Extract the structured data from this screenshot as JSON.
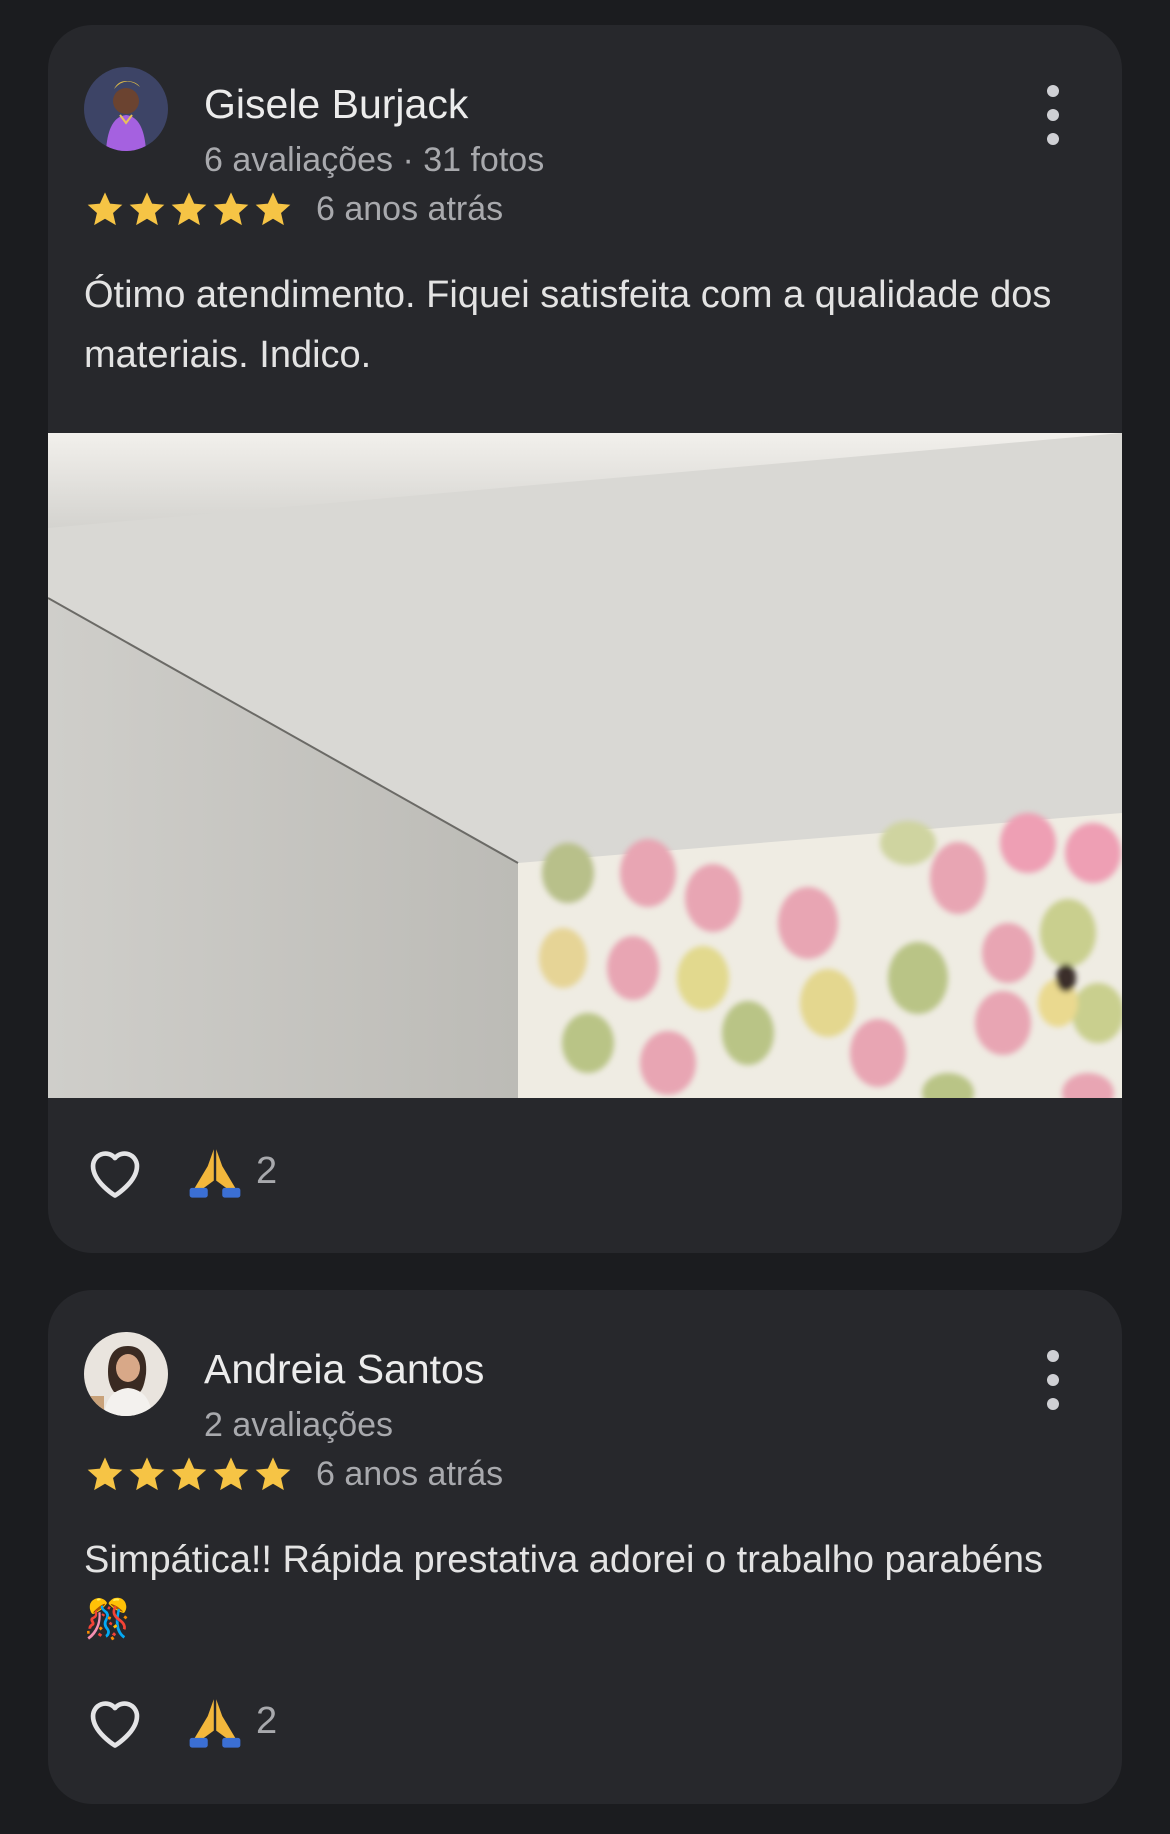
{
  "reviews": [
    {
      "author": "Gisele Burjack",
      "meta": "6 avaliações · 31 fotos",
      "rating": 5,
      "time": "6 anos atrás",
      "text": "Ótimo atendimento. Fiquei satisfeita com a qualidade dos materiais. Indico.",
      "has_photo": true,
      "reactions": {
        "emoji": "pray-icon",
        "count": "2"
      }
    },
    {
      "author": "Andreia Santos",
      "meta": "2 avaliações",
      "rating": 5,
      "time": "6 anos atrás",
      "text": "Simpática!! Rápida prestativa adorei o trabalho parabéns 🎊",
      "has_photo": false,
      "reactions": {
        "emoji": "pray-icon",
        "count": "2"
      }
    }
  ],
  "colors": {
    "background": "#1b1c1f",
    "card": "#27282c",
    "star": "#f6c445",
    "secondary_text": "#a8a9ad"
  }
}
